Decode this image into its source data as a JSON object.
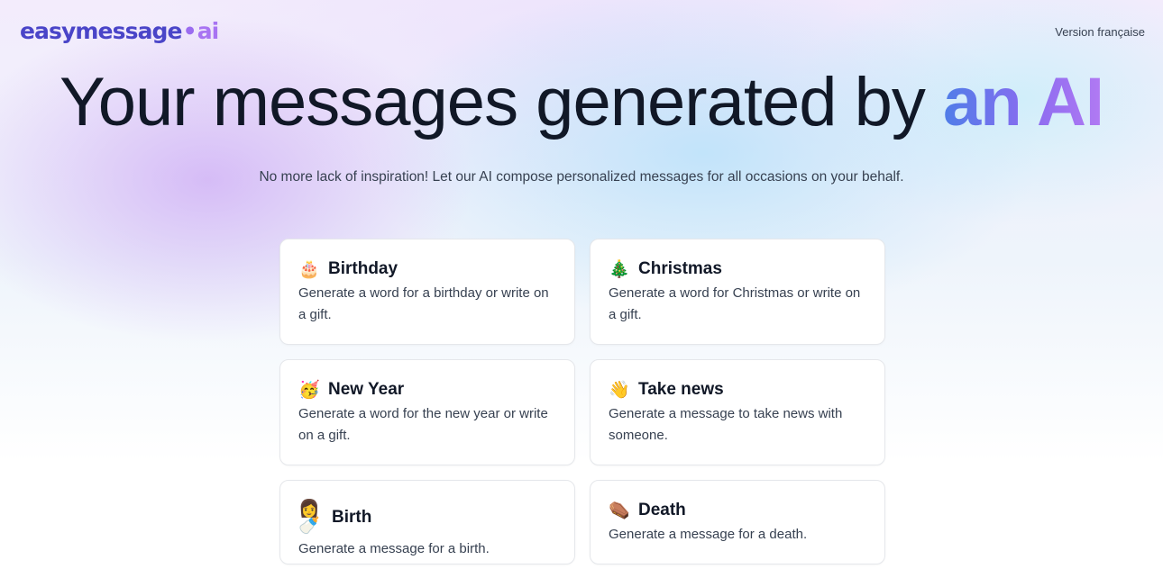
{
  "header": {
    "logo": {
      "part1": "easymessage",
      "dot": "•",
      "part2": "ai"
    },
    "language_link": "Version française"
  },
  "hero": {
    "headline_main": "Your messages generated by ",
    "headline_accent": "an AI",
    "subtitle": "No more lack of inspiration! Let our AI compose personalized messages for all occasions on your behalf."
  },
  "categories": [
    {
      "icon": "🎂",
      "icon_name": "birthday-cake-icon",
      "title": "Birthday",
      "description": "Generate a word for a birthday or write on a gift."
    },
    {
      "icon": "🎄",
      "icon_name": "christmas-tree-icon",
      "title": "Christmas",
      "description": "Generate a word for Christmas or write on a gift."
    },
    {
      "icon": "🥳",
      "icon_name": "party-face-icon",
      "title": "New Year",
      "description": "Generate a word for the new year or write on a gift."
    },
    {
      "icon": "👋",
      "icon_name": "waving-hand-icon",
      "title": "Take news",
      "description": "Generate a message to take news with someone."
    },
    {
      "icon": "👩🍼",
      "icon_name": "baby-bottle-icon",
      "title": "Birth",
      "description": "Generate a message for a birth."
    },
    {
      "icon": "⚰️",
      "icon_name": "coffin-icon",
      "title": "Death",
      "description": "Generate a message for a death."
    }
  ]
}
